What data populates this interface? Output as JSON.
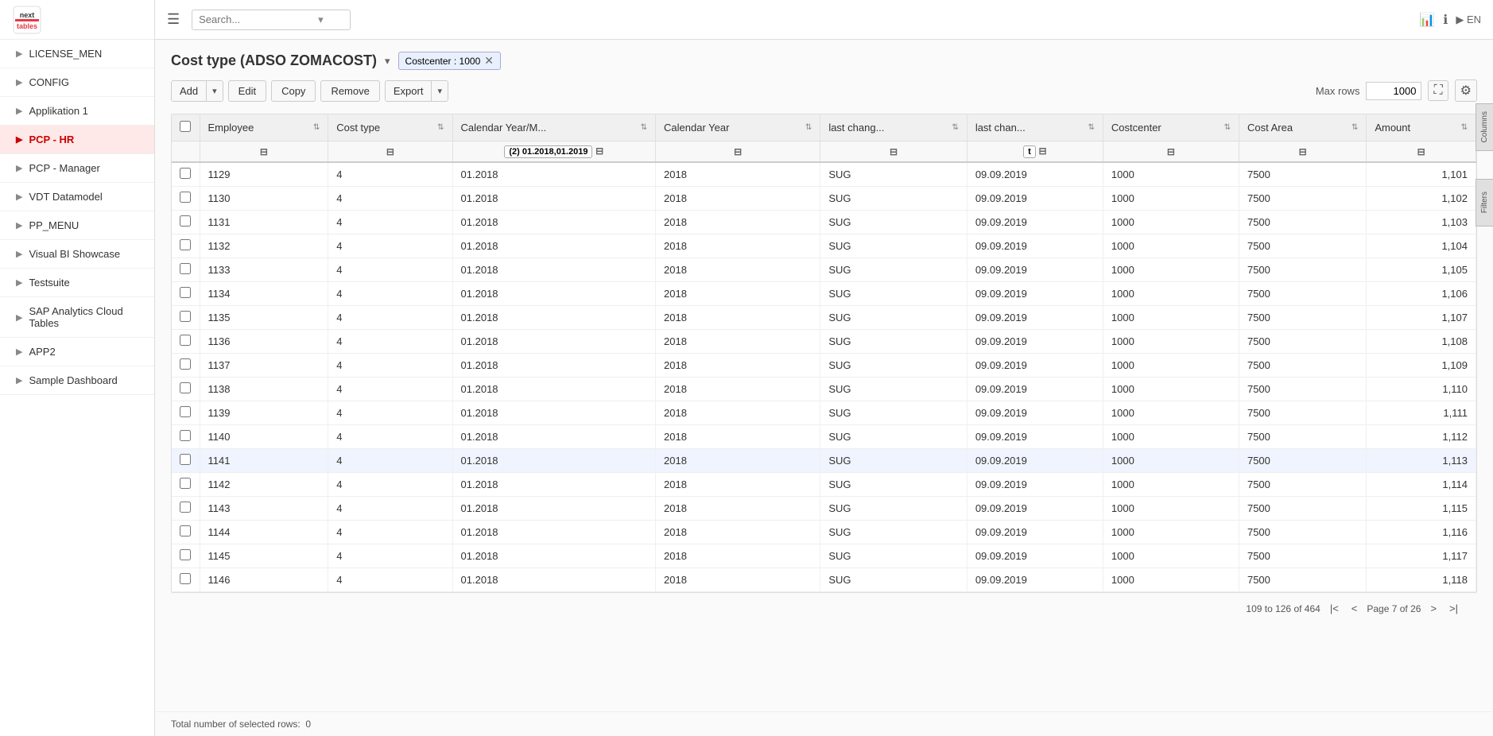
{
  "logo": {
    "line1": "next",
    "line2": "tables"
  },
  "topbar": {
    "search_placeholder": "Search...",
    "lang": "EN"
  },
  "sidebar": {
    "items": [
      {
        "id": "license-men",
        "label": "LICENSE_MEN",
        "active": false
      },
      {
        "id": "config",
        "label": "CONFIG",
        "active": false
      },
      {
        "id": "applikation-1",
        "label": "Applikation 1",
        "active": false
      },
      {
        "id": "pcp-hr",
        "label": "PCP - HR",
        "active": true
      },
      {
        "id": "pcp-manager",
        "label": "PCP - Manager",
        "active": false
      },
      {
        "id": "vdt-datamodel",
        "label": "VDT Datamodel",
        "active": false
      },
      {
        "id": "pp-menu",
        "label": "PP_MENU",
        "active": false
      },
      {
        "id": "visual-bi-showcase",
        "label": "Visual BI Showcase",
        "active": false
      },
      {
        "id": "testsuite",
        "label": "Testsuite",
        "active": false
      },
      {
        "id": "sap-analytics-cloud-tables",
        "label": "SAP Analytics Cloud Tables",
        "active": false
      },
      {
        "id": "app2",
        "label": "APP2",
        "active": false
      },
      {
        "id": "sample-dashboard",
        "label": "Sample Dashboard",
        "active": false
      }
    ]
  },
  "page": {
    "title": "Cost type (ADSO ZOMACOST)",
    "filter_label": "Costcenter : 1000"
  },
  "toolbar": {
    "add_label": "Add",
    "edit_label": "Edit",
    "copy_label": "Copy",
    "remove_label": "Remove",
    "export_label": "Export",
    "max_rows_label": "Max rows",
    "max_rows_value": "1000"
  },
  "table": {
    "columns": [
      {
        "id": "employee",
        "label": "Employee"
      },
      {
        "id": "cost-type",
        "label": "Cost type"
      },
      {
        "id": "calendar-year-month",
        "label": "Calendar Year/M..."
      },
      {
        "id": "calendar-year",
        "label": "Calendar Year"
      },
      {
        "id": "last-changed-by",
        "label": "last chang..."
      },
      {
        "id": "last-changed-on",
        "label": "last chan..."
      },
      {
        "id": "costcenter",
        "label": "Costcenter"
      },
      {
        "id": "cost-area",
        "label": "Cost Area"
      },
      {
        "id": "amount",
        "label": "Amount"
      }
    ],
    "filter_values": {
      "calendar-year-month": "(2) 01.2018,01.2019",
      "last-changed-on": "t"
    },
    "rows": [
      {
        "employee": "1129",
        "cost_type": "4",
        "cal_year_month": "01.2018",
        "cal_year": "2018",
        "last_changed_by": "SUG",
        "last_changed_on": "09.09.2019",
        "costcenter": "1000",
        "cost_area": "7500",
        "amount": "1,101",
        "highlighted": false
      },
      {
        "employee": "1130",
        "cost_type": "4",
        "cal_year_month": "01.2018",
        "cal_year": "2018",
        "last_changed_by": "SUG",
        "last_changed_on": "09.09.2019",
        "costcenter": "1000",
        "cost_area": "7500",
        "amount": "1,102",
        "highlighted": false
      },
      {
        "employee": "1131",
        "cost_type": "4",
        "cal_year_month": "01.2018",
        "cal_year": "2018",
        "last_changed_by": "SUG",
        "last_changed_on": "09.09.2019",
        "costcenter": "1000",
        "cost_area": "7500",
        "amount": "1,103",
        "highlighted": false
      },
      {
        "employee": "1132",
        "cost_type": "4",
        "cal_year_month": "01.2018",
        "cal_year": "2018",
        "last_changed_by": "SUG",
        "last_changed_on": "09.09.2019",
        "costcenter": "1000",
        "cost_area": "7500",
        "amount": "1,104",
        "highlighted": false
      },
      {
        "employee": "1133",
        "cost_type": "4",
        "cal_year_month": "01.2018",
        "cal_year": "2018",
        "last_changed_by": "SUG",
        "last_changed_on": "09.09.2019",
        "costcenter": "1000",
        "cost_area": "7500",
        "amount": "1,105",
        "highlighted": false
      },
      {
        "employee": "1134",
        "cost_type": "4",
        "cal_year_month": "01.2018",
        "cal_year": "2018",
        "last_changed_by": "SUG",
        "last_changed_on": "09.09.2019",
        "costcenter": "1000",
        "cost_area": "7500",
        "amount": "1,106",
        "highlighted": false
      },
      {
        "employee": "1135",
        "cost_type": "4",
        "cal_year_month": "01.2018",
        "cal_year": "2018",
        "last_changed_by": "SUG",
        "last_changed_on": "09.09.2019",
        "costcenter": "1000",
        "cost_area": "7500",
        "amount": "1,107",
        "highlighted": false
      },
      {
        "employee": "1136",
        "cost_type": "4",
        "cal_year_month": "01.2018",
        "cal_year": "2018",
        "last_changed_by": "SUG",
        "last_changed_on": "09.09.2019",
        "costcenter": "1000",
        "cost_area": "7500",
        "amount": "1,108",
        "highlighted": false
      },
      {
        "employee": "1137",
        "cost_type": "4",
        "cal_year_month": "01.2018",
        "cal_year": "2018",
        "last_changed_by": "SUG",
        "last_changed_on": "09.09.2019",
        "costcenter": "1000",
        "cost_area": "7500",
        "amount": "1,109",
        "highlighted": false
      },
      {
        "employee": "1138",
        "cost_type": "4",
        "cal_year_month": "01.2018",
        "cal_year": "2018",
        "last_changed_by": "SUG",
        "last_changed_on": "09.09.2019",
        "costcenter": "1000",
        "cost_area": "7500",
        "amount": "1,110",
        "highlighted": false
      },
      {
        "employee": "1139",
        "cost_type": "4",
        "cal_year_month": "01.2018",
        "cal_year": "2018",
        "last_changed_by": "SUG",
        "last_changed_on": "09.09.2019",
        "costcenter": "1000",
        "cost_area": "7500",
        "amount": "1,111",
        "highlighted": false
      },
      {
        "employee": "1140",
        "cost_type": "4",
        "cal_year_month": "01.2018",
        "cal_year": "2018",
        "last_changed_by": "SUG",
        "last_changed_on": "09.09.2019",
        "costcenter": "1000",
        "cost_area": "7500",
        "amount": "1,112",
        "highlighted": false
      },
      {
        "employee": "1141",
        "cost_type": "4",
        "cal_year_month": "01.2018",
        "cal_year": "2018",
        "last_changed_by": "SUG",
        "last_changed_on": "09.09.2019",
        "costcenter": "1000",
        "cost_area": "7500",
        "amount": "1,113",
        "highlighted": true
      },
      {
        "employee": "1142",
        "cost_type": "4",
        "cal_year_month": "01.2018",
        "cal_year": "2018",
        "last_changed_by": "SUG",
        "last_changed_on": "09.09.2019",
        "costcenter": "1000",
        "cost_area": "7500",
        "amount": "1,114",
        "highlighted": false
      },
      {
        "employee": "1143",
        "cost_type": "4",
        "cal_year_month": "01.2018",
        "cal_year": "2018",
        "last_changed_by": "SUG",
        "last_changed_on": "09.09.2019",
        "costcenter": "1000",
        "cost_area": "7500",
        "amount": "1,115",
        "highlighted": false
      },
      {
        "employee": "1144",
        "cost_type": "4",
        "cal_year_month": "01.2018",
        "cal_year": "2018",
        "last_changed_by": "SUG",
        "last_changed_on": "09.09.2019",
        "costcenter": "1000",
        "cost_area": "7500",
        "amount": "1,116",
        "highlighted": false
      },
      {
        "employee": "1145",
        "cost_type": "4",
        "cal_year_month": "01.2018",
        "cal_year": "2018",
        "last_changed_by": "SUG",
        "last_changed_on": "09.09.2019",
        "costcenter": "1000",
        "cost_area": "7500",
        "amount": "1,117",
        "highlighted": false
      },
      {
        "employee": "1146",
        "cost_type": "4",
        "cal_year_month": "01.2018",
        "cal_year": "2018",
        "last_changed_by": "SUG",
        "last_changed_on": "09.09.2019",
        "costcenter": "1000",
        "cost_area": "7500",
        "amount": "1,118",
        "highlighted": false
      }
    ]
  },
  "pagination": {
    "range": "109 to 126 of 464",
    "page_info": "Page 7 of 26"
  },
  "status": {
    "selected_rows_label": "Total number of selected rows:",
    "selected_rows_count": "0"
  },
  "side_panels": {
    "columns_label": "Columns",
    "filters_label": "Filters"
  }
}
